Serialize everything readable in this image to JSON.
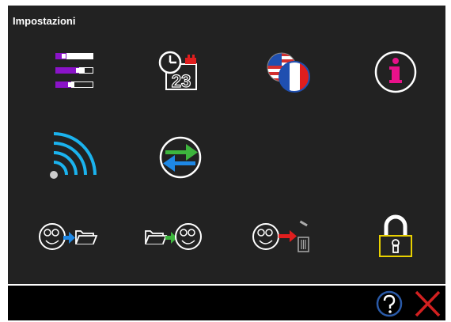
{
  "window": {
    "title": "Impostazioni"
  },
  "grid": [
    {
      "id": "display-settings",
      "icon": "settings-bars-icon"
    },
    {
      "id": "date-time",
      "icon": "clock-calendar-icon"
    },
    {
      "id": "language",
      "icon": "language-flags-icon"
    },
    {
      "id": "info",
      "icon": "info-icon"
    },
    {
      "id": "wifi",
      "icon": "wifi-icon"
    },
    {
      "id": "sync",
      "icon": "sync-arrows-icon"
    },
    {
      "id": "import-from-folder",
      "icon": "face-import-folder-icon"
    },
    {
      "id": "export-to-folder",
      "icon": "folder-export-face-icon"
    },
    {
      "id": "delete-to-trash",
      "icon": "face-delete-trash-icon"
    },
    {
      "id": "lock",
      "icon": "padlock-icon"
    }
  ],
  "footer": {
    "help_icon": "help-icon",
    "close_icon": "close-icon"
  },
  "colors": {
    "background": "#222222",
    "purple": "#8a13c8",
    "pink": "#e8118a",
    "blue": "#1e88e5",
    "cyan": "#1bb3ee",
    "green": "#3db53d",
    "red": "#e01e1e",
    "yellow": "#e8d000",
    "dark_blue_outline": "#2a5aa8"
  },
  "date_numeral": "23"
}
